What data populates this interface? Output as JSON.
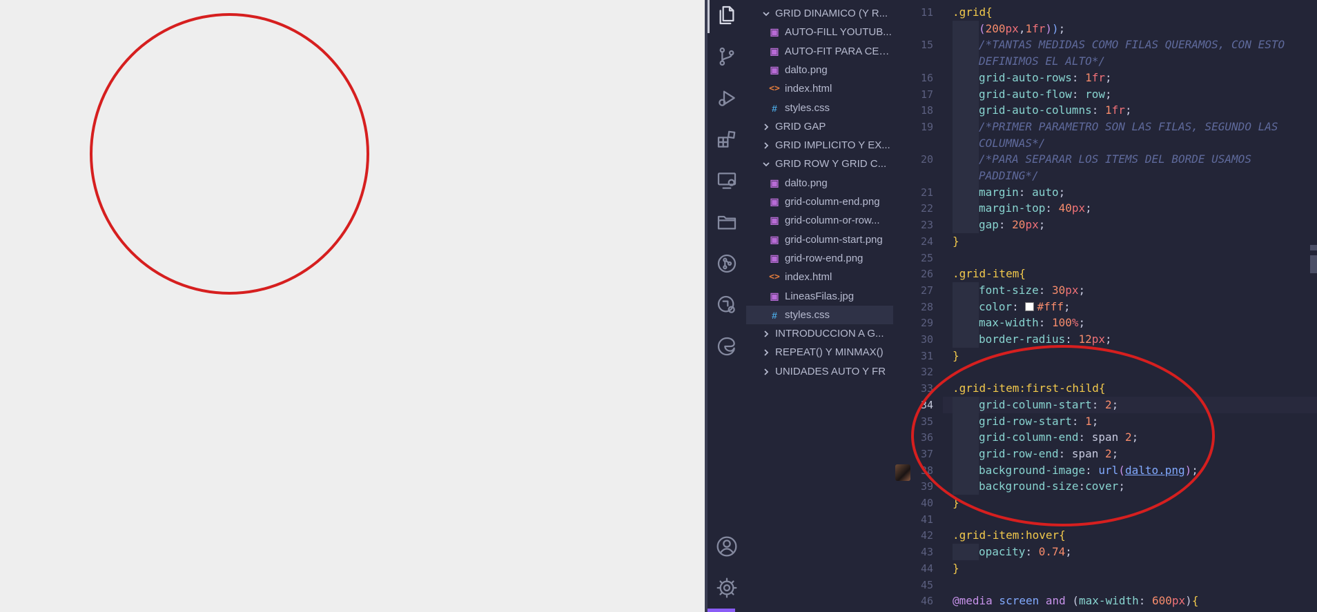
{
  "colors": {
    "preview_bg": "#eeeeee",
    "editor_bg": "#232537",
    "highlight_circle": "#d61f1f",
    "accent": "#8a5cf6"
  },
  "activity_bar": {
    "top": [
      "files-icon",
      "source-control-icon",
      "run-debug-icon",
      "extensions-icon",
      "remote-explorer-icon",
      "folder-icon",
      "git-graph-icon",
      "live-share-icon",
      "edge-icon"
    ],
    "bottom": [
      "account-icon",
      "settings-gear-icon"
    ]
  },
  "explorer": {
    "items": [
      {
        "type": "folder",
        "state": "open",
        "label": "GRID DINAMICO (Y R..."
      },
      {
        "type": "file",
        "kind": "png",
        "label": "AUTO-FILL YOUTUB..."
      },
      {
        "type": "file",
        "kind": "png",
        "label": "AUTO-FIT PARA CEN..."
      },
      {
        "type": "file",
        "kind": "png",
        "label": "dalto.png"
      },
      {
        "type": "file",
        "kind": "html",
        "label": "index.html"
      },
      {
        "type": "file",
        "kind": "css",
        "label": "styles.css"
      },
      {
        "type": "folder",
        "state": "closed",
        "label": "GRID GAP"
      },
      {
        "type": "folder",
        "state": "closed",
        "label": "GRID IMPLICITO Y EX..."
      },
      {
        "type": "folder",
        "state": "open",
        "label": "GRID ROW Y GRID C..."
      },
      {
        "type": "file",
        "kind": "png",
        "label": "dalto.png"
      },
      {
        "type": "file",
        "kind": "png",
        "label": "grid-column-end.png"
      },
      {
        "type": "file",
        "kind": "png",
        "label": "grid-column-or-row..."
      },
      {
        "type": "file",
        "kind": "png",
        "label": "grid-column-start.png"
      },
      {
        "type": "file",
        "kind": "png",
        "label": "grid-row-end.png"
      },
      {
        "type": "file",
        "kind": "html",
        "label": "index.html"
      },
      {
        "type": "file",
        "kind": "jpg",
        "label": "LineasFilas.jpg"
      },
      {
        "type": "file",
        "kind": "css",
        "label": "styles.css",
        "selected": true
      },
      {
        "type": "folder",
        "state": "closed",
        "label": "INTRODUCCION A G..."
      },
      {
        "type": "folder",
        "state": "closed",
        "label": "REPEAT() Y MINMAX()"
      },
      {
        "type": "folder",
        "state": "closed",
        "label": "UNIDADES AUTO Y FR"
      }
    ]
  },
  "editor": {
    "active_line": "34",
    "lines": [
      {
        "n": "11",
        "indent": 0,
        "parts": [
          [
            ".grid",
            "sel"
          ],
          [
            "{",
            "brace"
          ]
        ]
      },
      {
        "n": "",
        "indent": 1,
        "parts": [
          [
            "(",
            "paren"
          ],
          [
            "200",
            "num"
          ],
          [
            "px",
            "unit"
          ],
          [
            ",",
            "punct"
          ],
          [
            "1",
            "num"
          ],
          [
            "fr",
            "unit"
          ],
          [
            ")",
            "paren"
          ],
          [
            ")",
            "fn"
          ],
          [
            ";",
            "punct"
          ]
        ]
      },
      {
        "n": "15",
        "indent": 1,
        "parts": [
          [
            "/*TANTAS MEDIDAS COMO FILAS QUERAMOS, CON ESTO",
            "cmt"
          ]
        ]
      },
      {
        "n": "",
        "indent": 1,
        "parts": [
          [
            "DEFINIMOS EL ALTO*/",
            "cmt"
          ]
        ]
      },
      {
        "n": "16",
        "indent": 1,
        "parts": [
          [
            "grid-auto-rows",
            "prop"
          ],
          [
            ": ",
            "punct"
          ],
          [
            "1",
            "num"
          ],
          [
            "fr",
            "unit"
          ],
          [
            ";",
            "punct"
          ]
        ]
      },
      {
        "n": "17",
        "indent": 1,
        "parts": [
          [
            "grid-auto-flow",
            "prop"
          ],
          [
            ": ",
            "punct"
          ],
          [
            "row",
            "prop"
          ],
          [
            ";",
            "punct"
          ]
        ]
      },
      {
        "n": "18",
        "indent": 1,
        "parts": [
          [
            "grid-auto-columns",
            "prop"
          ],
          [
            ": ",
            "punct"
          ],
          [
            "1",
            "num"
          ],
          [
            "fr",
            "unit"
          ],
          [
            ";",
            "punct"
          ]
        ]
      },
      {
        "n": "19",
        "indent": 1,
        "parts": [
          [
            "/*PRIMER PARAMETRO SON LAS FILAS, SEGUNDO LAS",
            "cmt"
          ]
        ]
      },
      {
        "n": "",
        "indent": 1,
        "parts": [
          [
            "COLUMNAS*/",
            "cmt"
          ]
        ]
      },
      {
        "n": "20",
        "indent": 1,
        "parts": [
          [
            "/*PARA SEPARAR LOS ITEMS DEL BORDE USAMOS",
            "cmt"
          ]
        ]
      },
      {
        "n": "",
        "indent": 1,
        "parts": [
          [
            "PADDING*/",
            "cmt"
          ]
        ]
      },
      {
        "n": "21",
        "indent": 1,
        "parts": [
          [
            "margin",
            "prop"
          ],
          [
            ": ",
            "punct"
          ],
          [
            "auto",
            "prop"
          ],
          [
            ";",
            "punct"
          ]
        ]
      },
      {
        "n": "22",
        "indent": 1,
        "parts": [
          [
            "margin-top",
            "prop"
          ],
          [
            ": ",
            "punct"
          ],
          [
            "40",
            "num"
          ],
          [
            "px",
            "unit"
          ],
          [
            ";",
            "punct"
          ]
        ]
      },
      {
        "n": "23",
        "indent": 1,
        "parts": [
          [
            "gap",
            "prop"
          ],
          [
            ": ",
            "punct"
          ],
          [
            "20",
            "num"
          ],
          [
            "px",
            "unit"
          ],
          [
            ";",
            "punct"
          ]
        ]
      },
      {
        "n": "24",
        "indent": 0,
        "parts": [
          [
            "}",
            "brace"
          ]
        ]
      },
      {
        "n": "25",
        "indent": 0,
        "parts": []
      },
      {
        "n": "26",
        "indent": 0,
        "parts": [
          [
            ".grid-item",
            "sel"
          ],
          [
            "{",
            "brace"
          ]
        ]
      },
      {
        "n": "27",
        "indent": 1,
        "parts": [
          [
            "font-size",
            "prop"
          ],
          [
            ": ",
            "punct"
          ],
          [
            "30",
            "num"
          ],
          [
            "px",
            "unit"
          ],
          [
            ";",
            "punct"
          ]
        ]
      },
      {
        "n": "28",
        "indent": 1,
        "parts": [
          [
            "color",
            "prop"
          ],
          [
            ": ",
            "punct"
          ],
          [
            "SWATCH",
            "swatch"
          ],
          [
            "#fff",
            "num"
          ],
          [
            ";",
            "punct"
          ]
        ]
      },
      {
        "n": "29",
        "indent": 1,
        "parts": [
          [
            "max-width",
            "prop"
          ],
          [
            ": ",
            "punct"
          ],
          [
            "100",
            "num"
          ],
          [
            "%",
            "unit"
          ],
          [
            ";",
            "punct"
          ]
        ]
      },
      {
        "n": "30",
        "indent": 1,
        "parts": [
          [
            "border-radius",
            "prop"
          ],
          [
            ": ",
            "punct"
          ],
          [
            "12",
            "num"
          ],
          [
            "px",
            "unit"
          ],
          [
            ";",
            "punct"
          ]
        ]
      },
      {
        "n": "31",
        "indent": 0,
        "parts": [
          [
            "}",
            "brace"
          ]
        ]
      },
      {
        "n": "32",
        "indent": 0,
        "parts": []
      },
      {
        "n": "33",
        "indent": 0,
        "parts": [
          [
            ".grid-item:first-child",
            "sel"
          ],
          [
            "{",
            "brace"
          ]
        ]
      },
      {
        "n": "34",
        "indent": 1,
        "current": true,
        "parts": [
          [
            "grid-column-start",
            "prop"
          ],
          [
            ": ",
            "punct"
          ],
          [
            "2",
            "num"
          ],
          [
            ";",
            "punct"
          ]
        ]
      },
      {
        "n": "35",
        "indent": 1,
        "parts": [
          [
            "grid-row-start",
            "prop"
          ],
          [
            ": ",
            "punct"
          ],
          [
            "1",
            "num"
          ],
          [
            ";",
            "punct"
          ]
        ]
      },
      {
        "n": "36",
        "indent": 1,
        "parts": [
          [
            "grid-column-end",
            "prop"
          ],
          [
            ": ",
            "punct"
          ],
          [
            "span ",
            "punct"
          ],
          [
            "2",
            "num"
          ],
          [
            ";",
            "punct"
          ]
        ]
      },
      {
        "n": "37",
        "indent": 1,
        "parts": [
          [
            "grid-row-end",
            "prop"
          ],
          [
            ": ",
            "punct"
          ],
          [
            "span ",
            "punct"
          ],
          [
            "2",
            "num"
          ],
          [
            ";",
            "punct"
          ]
        ]
      },
      {
        "n": "38",
        "indent": 1,
        "parts": [
          [
            "background-image",
            "prop"
          ],
          [
            ": ",
            "punct"
          ],
          [
            "url",
            "fn"
          ],
          [
            "(",
            "paren"
          ],
          [
            "dalto.png",
            "link"
          ],
          [
            ")",
            "paren"
          ],
          [
            ";",
            "punct"
          ]
        ]
      },
      {
        "n": "39",
        "indent": 1,
        "parts": [
          [
            "background-size",
            "prop"
          ],
          [
            ":",
            "punct"
          ],
          [
            "cover",
            "prop"
          ],
          [
            ";",
            "punct"
          ]
        ]
      },
      {
        "n": "40",
        "indent": 0,
        "parts": [
          [
            "}",
            "brace"
          ]
        ]
      },
      {
        "n": "41",
        "indent": 0,
        "parts": []
      },
      {
        "n": "42",
        "indent": 0,
        "parts": [
          [
            ".grid-item:hover",
            "sel"
          ],
          [
            "{",
            "brace"
          ]
        ]
      },
      {
        "n": "43",
        "indent": 1,
        "parts": [
          [
            "opacity",
            "prop"
          ],
          [
            ": ",
            "punct"
          ],
          [
            "0.74",
            "num"
          ],
          [
            ";",
            "punct"
          ]
        ]
      },
      {
        "n": "44",
        "indent": 0,
        "parts": [
          [
            "}",
            "brace"
          ]
        ]
      },
      {
        "n": "45",
        "indent": 0,
        "parts": []
      },
      {
        "n": "46",
        "indent": 0,
        "parts": [
          [
            "@media",
            "at"
          ],
          [
            " screen ",
            "fn"
          ],
          [
            "and",
            "at"
          ],
          [
            " (",
            "punct"
          ],
          [
            "max-width",
            "prop"
          ],
          [
            ": ",
            "punct"
          ],
          [
            "600",
            "num"
          ],
          [
            "px",
            "unit"
          ],
          [
            ")",
            "punct"
          ],
          [
            "{",
            "brace"
          ]
        ]
      }
    ]
  }
}
